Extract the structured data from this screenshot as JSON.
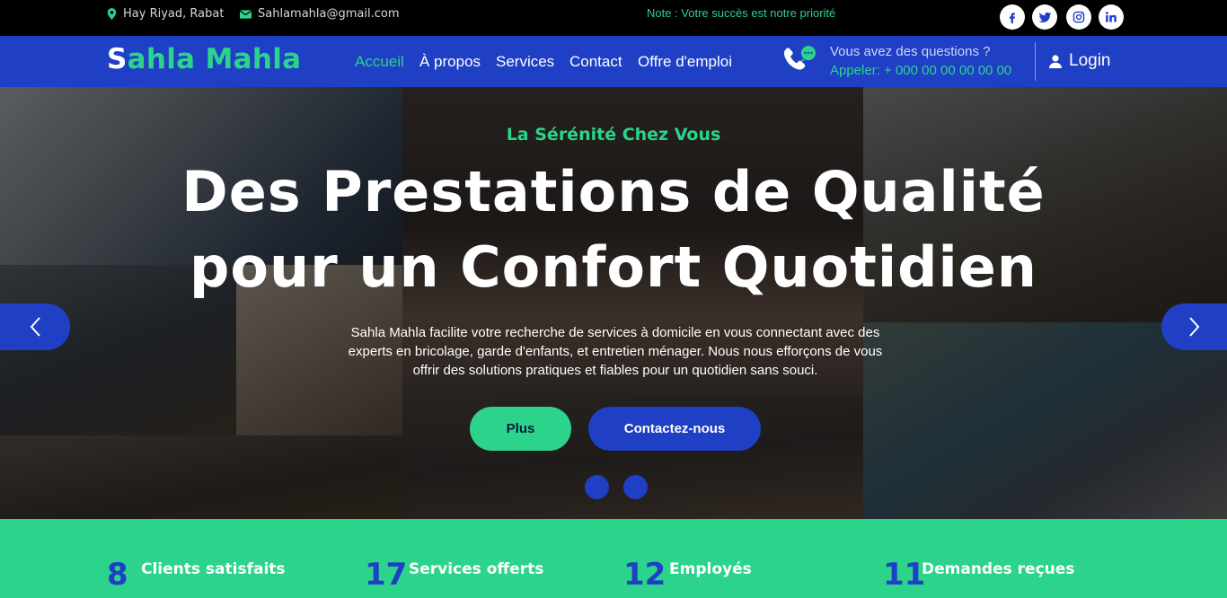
{
  "topbar": {
    "address": "Hay Riyad, Rabat",
    "email": "Sahlamahla@gmail.com",
    "note": "Note : Votre succès est notre priorité",
    "social": [
      "facebook-icon",
      "twitter-icon",
      "instagram-icon",
      "linkedin-icon"
    ]
  },
  "navbar": {
    "logo_first": "S",
    "logo_rest": "ahla Mahla",
    "links": [
      "Accueil",
      "À propos",
      "Services",
      "Contact",
      "Offre d'emploi"
    ],
    "active_link": "Accueil",
    "question_label": "Vous avez des questions ?",
    "phone_text": "Appeler: + 000 00 00 00 00 00",
    "login_label": "Login"
  },
  "hero": {
    "eyebrow": "La Sérénité Chez Vous",
    "headline_line1": "Des Prestations de Qualité",
    "headline_line2": "pour un Confort Quotidien",
    "description": "Sahla Mahla facilite votre recherche de services à domicile en vous connectant avec des experts en bricolage, garde d'enfants, et entretien ménager. Nous nous efforçons de vous offrir des solutions pratiques et fiables pour un quotidien sans souci.",
    "primary_button": "Plus",
    "secondary_button": "Contactez-nous",
    "slide_count": 2
  },
  "stats": [
    {
      "value": "8",
      "label": "Clients satisfaits"
    },
    {
      "value": "17",
      "label": "Services offerts"
    },
    {
      "value": "12",
      "label": "Employés"
    },
    {
      "value": "11",
      "label": "Demandes reçues"
    }
  ],
  "colors": {
    "brand_blue": "#1f3fc4",
    "brand_green": "#2bd48a",
    "topbar_bg": "#000000"
  }
}
